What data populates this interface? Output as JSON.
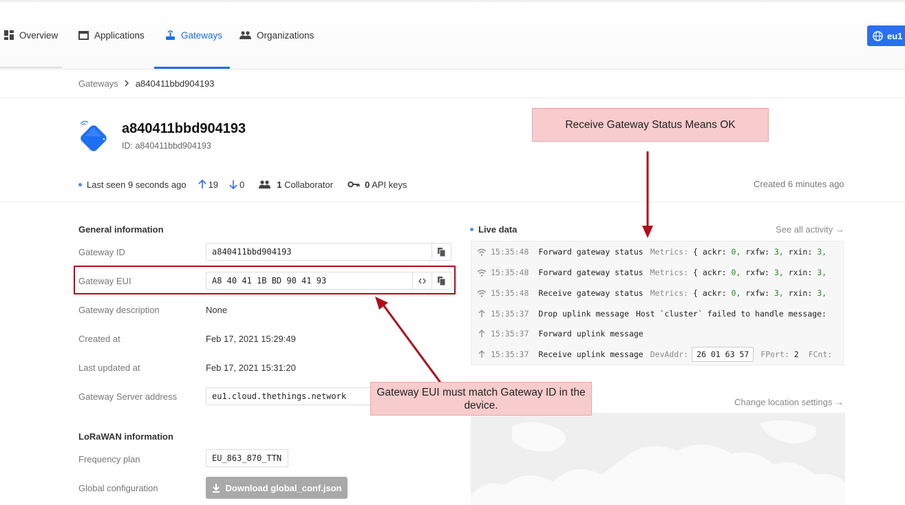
{
  "nav": {
    "items": [
      {
        "label": "Overview",
        "icon": "dashboard-icon"
      },
      {
        "label": "Applications",
        "icon": "window-icon"
      },
      {
        "label": "Gateways",
        "icon": "router-icon",
        "active": true
      },
      {
        "label": "Organizations",
        "icon": "people-icon"
      }
    ],
    "region": "eu1",
    "accent": "#1c6ee8"
  },
  "breadcrumb": {
    "parent": "Gateways",
    "current": "a840411bbd904193"
  },
  "gateway": {
    "name": "a840411bbd904193",
    "id_label": "ID:",
    "id_value": "a840411bbd904193",
    "last_seen": "Last seen 9 seconds ago",
    "up_count": "19",
    "down_count": "0",
    "collaborators_num": "1",
    "collaborators_label": "Collaborator",
    "api_keys_num": "0",
    "api_keys_label": "API keys",
    "created": "Created 6 minutes ago"
  },
  "general": {
    "title": "General information",
    "gateway_id_label": "Gateway ID",
    "gateway_id": "a840411bbd904193",
    "gateway_eui_label": "Gateway EUI",
    "gateway_eui": "A8 40 41 1B BD 90 41 93",
    "description_label": "Gateway description",
    "description": "None",
    "created_label": "Created at",
    "created": "Feb 17, 2021 15:29:49",
    "updated_label": "Last updated at",
    "updated": "Feb 17, 2021 15:31:20",
    "server_label": "Gateway Server address",
    "server": "eu1.cloud.thethings.network"
  },
  "lorawan": {
    "title": "LoRaWAN information",
    "freq_label": "Frequency plan",
    "freq": "EU_863_870_TTN",
    "global_label": "Global configuration",
    "download_label": "Download global_conf.json"
  },
  "live": {
    "title": "Live data",
    "see_all": "See all activity →",
    "events": [
      {
        "time": "15:35:48",
        "name": "Forward gateway status",
        "meta_label": "Metrics:",
        "brace": "{",
        "k1": "ackr:",
        "v1": "0,",
        "k2": "rxfw:",
        "v2": "3,",
        "k3": "rxin:",
        "v3": "3,"
      },
      {
        "time": "15:35:48",
        "name": "Forward gateway status",
        "meta_label": "Metrics:",
        "brace": "{",
        "k1": "ackr:",
        "v1": "0,",
        "k2": "rxfw:",
        "v2": "3,",
        "k3": "rxin:",
        "v3": "3,"
      },
      {
        "time": "15:35:48",
        "name": "Receive gateway status",
        "meta_label": "Metrics:",
        "brace": "{",
        "k1": "ackr:",
        "v1": "0,",
        "k2": "rxfw:",
        "v2": "3,",
        "k3": "rxin:",
        "v3": "3,"
      },
      {
        "time": "15:35:37",
        "name": "Drop uplink message",
        "meta": "Host `cluster` failed to handle message:"
      },
      {
        "time": "15:35:37",
        "name": "Forward uplink message"
      },
      {
        "time": "15:35:37",
        "name": "Receive uplink message",
        "devaddr_label": "DevAddr:",
        "devaddr": "26 01 63 57",
        "fport_label": "FPort:",
        "fport": "2",
        "fcnt_label": "FCnt:"
      }
    ]
  },
  "location": {
    "change": "Change location settings →"
  },
  "annotations": {
    "status_ok": "Receive Gateway Status Means OK",
    "eui_match": "Gateway EUI must match Gateway ID in the device.",
    "color": "#b00d1a"
  }
}
